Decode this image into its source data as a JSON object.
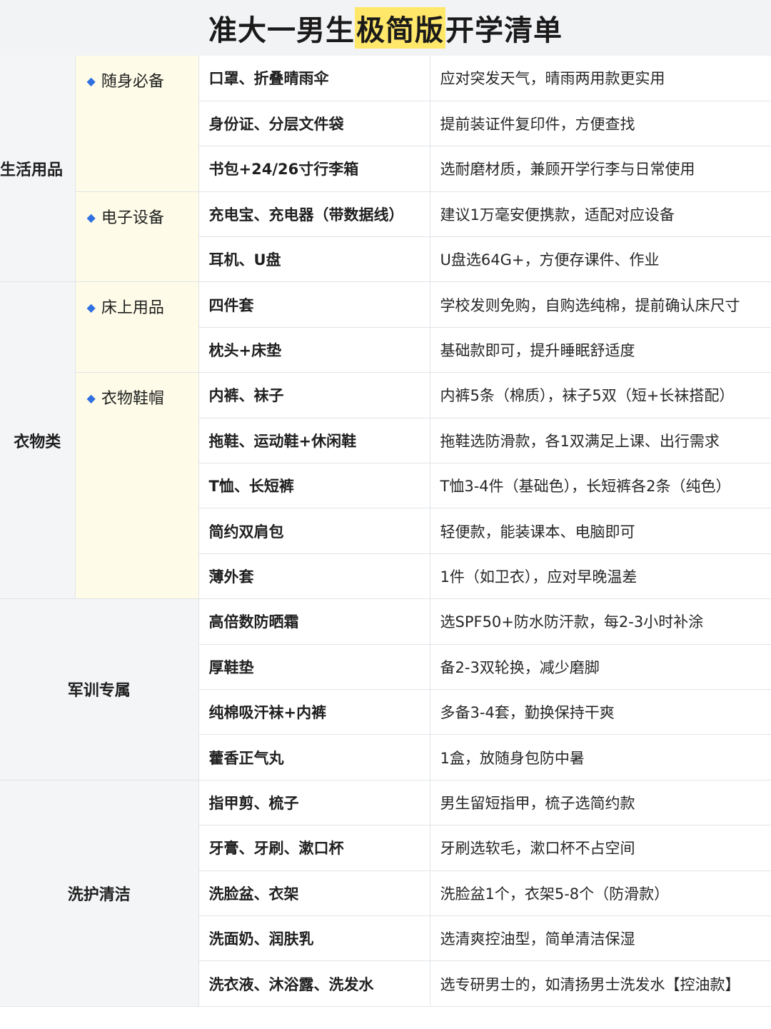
{
  "title": {
    "before": "准大一男生",
    "highlight": "极简版",
    "after": "开学清单"
  },
  "groups": {
    "life": "生活用品",
    "clothes": "衣物类",
    "military": "军训专属",
    "wash": "洗护清洁"
  },
  "subs": {
    "carry": "随身必备",
    "elec": "电子设备",
    "bed": "床上用品",
    "wear": "衣物鞋帽"
  },
  "rows": [
    {
      "item": "口罩、折叠晴雨伞",
      "note": "应对突发天气，晴雨两用款更实用"
    },
    {
      "item": "身份证、分层文件袋",
      "note": "提前装证件复印件，方便查找"
    },
    {
      "item": "书包+24/26寸行李箱",
      "note": "选耐磨材质，兼顾开学行李与日常使用"
    },
    {
      "item": "充电宝、充电器（带数据线）",
      "note": "建议1万毫安便携款，适配对应设备"
    },
    {
      "item": "耳机、U盘",
      "note": "U盘选64G+，方便存课件、作业"
    },
    {
      "item": "四件套",
      "note": "学校发则免购，自购选纯棉，提前确认床尺寸"
    },
    {
      "item": "枕头+床垫",
      "note": "基础款即可，提升睡眠舒适度"
    },
    {
      "item": "内裤、袜子",
      "note": "内裤5条（棉质），袜子5双（短+长袜搭配）"
    },
    {
      "item": "拖鞋、运动鞋+休闲鞋",
      "note": "拖鞋选防滑款，各1双满足上课、出行需求"
    },
    {
      "item": "T恤、长短裤",
      "note": "T恤3-4件（基础色），长短裤各2条（纯色）"
    },
    {
      "item": "简约双肩包",
      "note": "轻便款，能装课本、电脑即可"
    },
    {
      "item": "薄外套",
      "note": "1件（如卫衣），应对早晚温差"
    },
    {
      "item": "高倍数防晒霜",
      "note": "选SPF50+防水防汗款，每2-3小时补涂"
    },
    {
      "item": "厚鞋垫",
      "note": "备2-3双轮换，减少磨脚"
    },
    {
      "item": "纯棉吸汗袜+内裤",
      "note": "多备3-4套，勤换保持干爽"
    },
    {
      "item": "藿香正气丸",
      "note": "1盒，放随身包防中暑"
    },
    {
      "item": "指甲剪、梳子",
      "note": "男生留短指甲，梳子选简约款"
    },
    {
      "item": "牙膏、牙刷、漱口杯",
      "note": "牙刷选软毛，漱口杯不占空间"
    },
    {
      "item": "洗脸盆、衣架",
      "note": "洗脸盆1个，衣架5-8个（防滑款）"
    },
    {
      "item": "洗面奶、润肤乳",
      "note": "选清爽控油型，简单清洁保湿"
    },
    {
      "item": "洗衣液、沐浴露、洗发水",
      "note": "选专研男士的，如清扬男士洗发水【控油款】"
    }
  ]
}
